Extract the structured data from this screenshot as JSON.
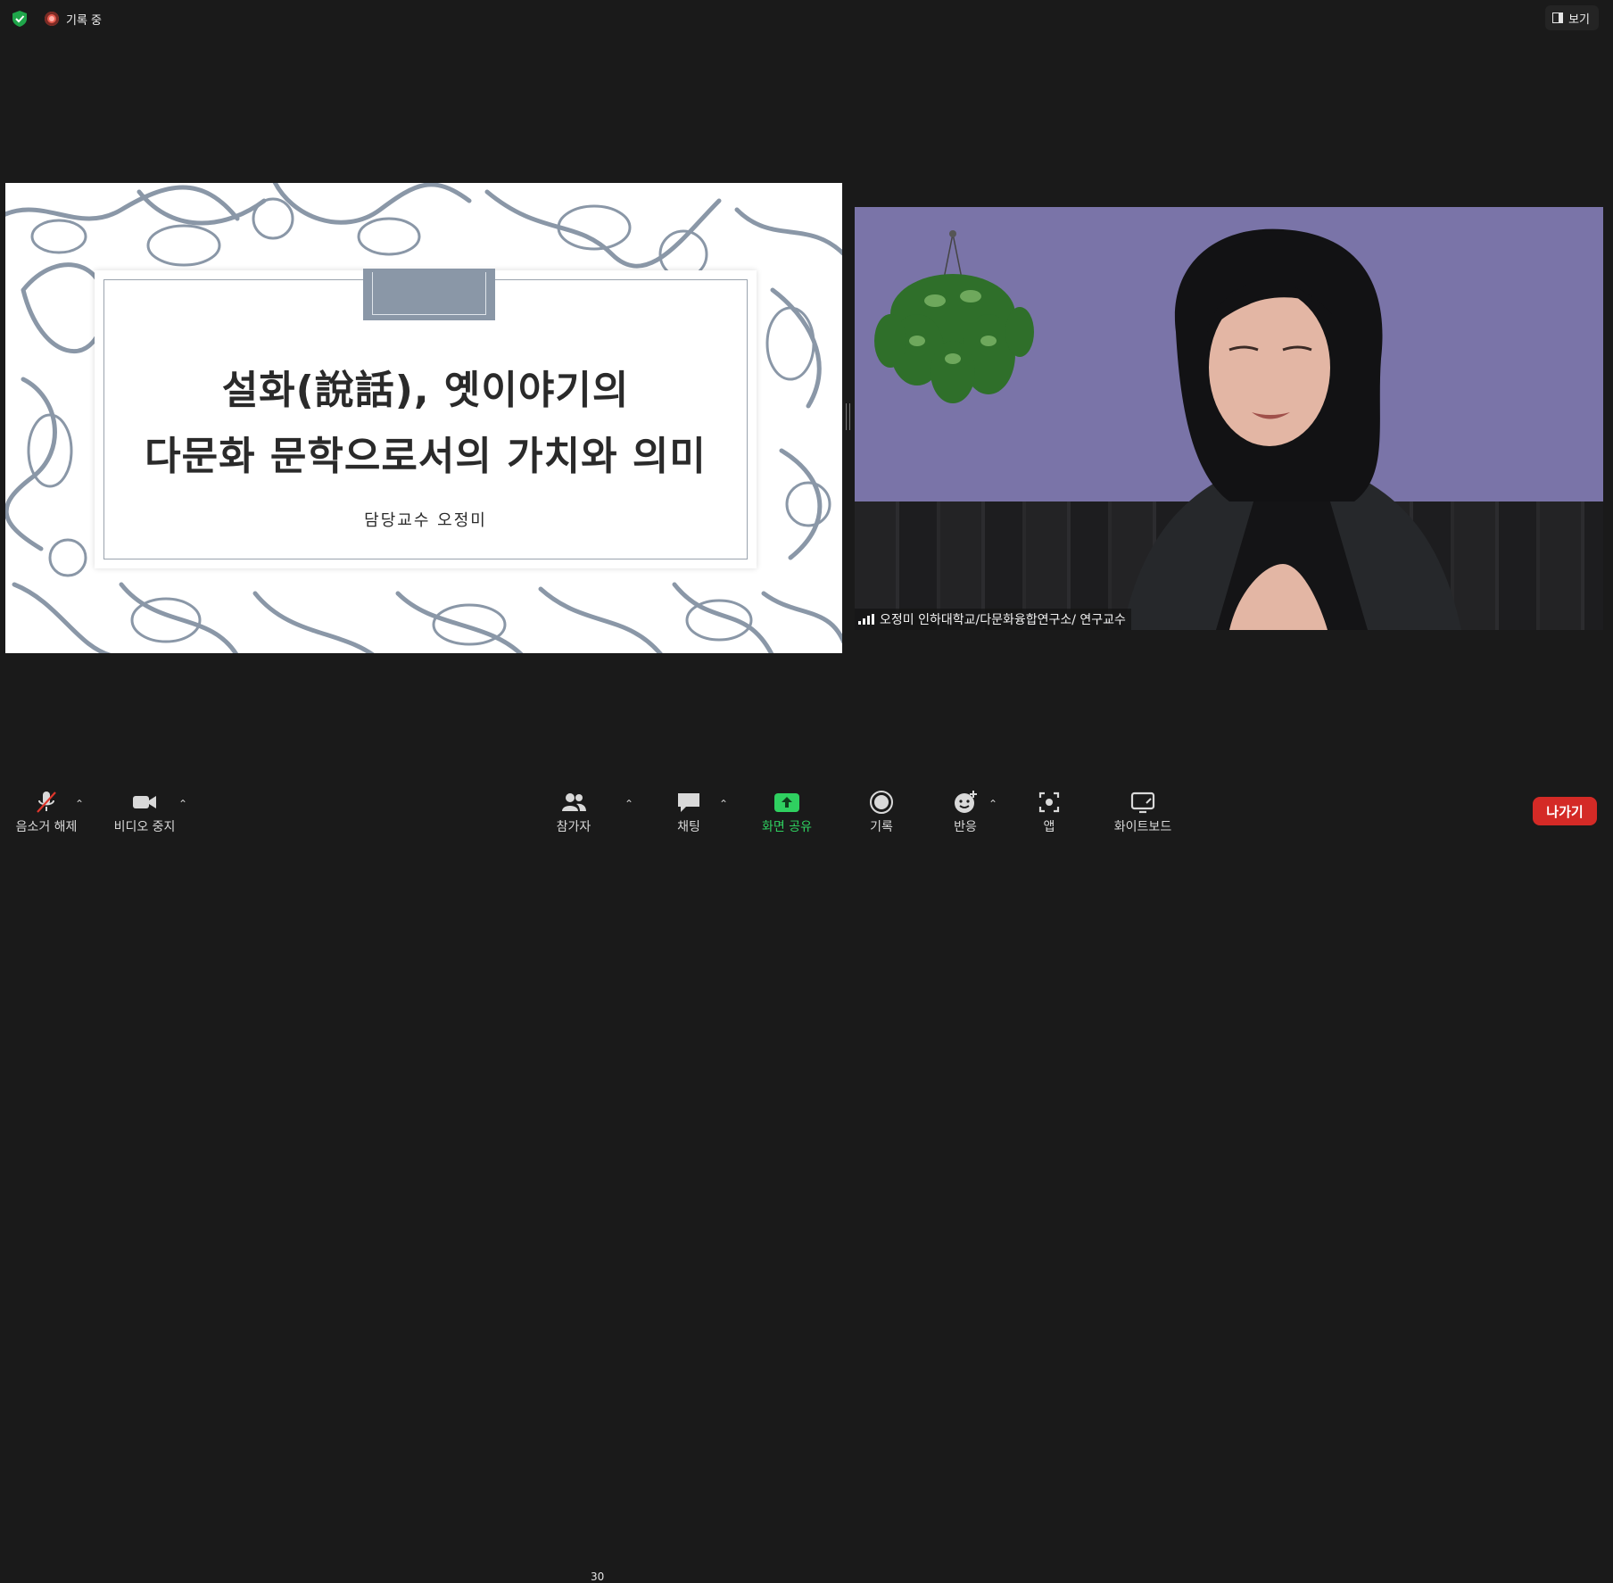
{
  "top_bar": {
    "recording_label": "기록 중",
    "view_label": "보기"
  },
  "slide": {
    "title_line1": "설화(說話), 옛이야기의",
    "title_line2": "다문화 문학으로서의 가치와 의미",
    "subtitle": "담당교수 오정미"
  },
  "camera": {
    "participant_label": "오정미 인하대학교/다문화융합연구소/ 연구교수"
  },
  "toolbar": {
    "mute_label": "음소거 해제",
    "video_label": "비디오 중지",
    "participants_label": "참가자",
    "participants_count": "30",
    "chat_label": "채팅",
    "share_label": "화면 공유",
    "record_label": "기록",
    "reactions_label": "반응",
    "apps_label": "앱",
    "whiteboard_label": "화이트보드",
    "leave_label": "나가기"
  },
  "colors": {
    "background": "#1a1a1a",
    "share_green": "#2fd060",
    "leave_red": "#d42a26",
    "slide_pattern": "#8a97a7"
  }
}
